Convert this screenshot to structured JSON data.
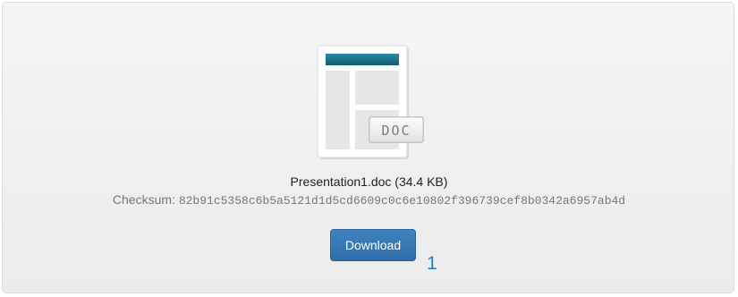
{
  "file": {
    "name": "Presentation1.doc",
    "size": "(34.4 KB)",
    "type_label": "DOC",
    "icon": "document-icon"
  },
  "checksum": {
    "label": "Checksum:",
    "value": "82b91c5358c6b5a5121d1d5cd6609c0c6e10802f396739cef8b0342a6957ab4d"
  },
  "download": {
    "label": "Download"
  },
  "annotation": {
    "number": "1"
  },
  "colors": {
    "accent": "#3377b6",
    "doc_header": "#1f7a94",
    "annotation": "#1a7ee0"
  }
}
